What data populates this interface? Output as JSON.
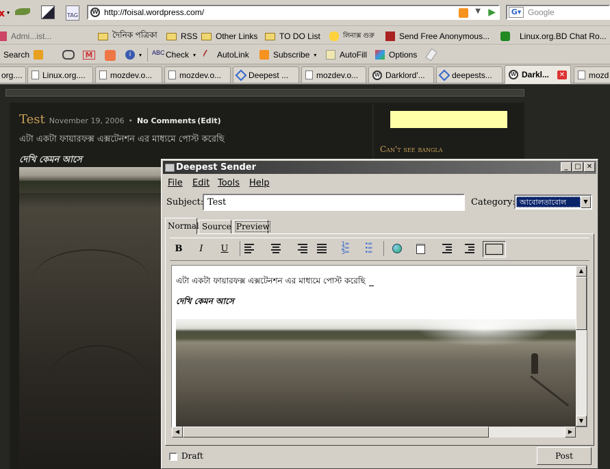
{
  "browser": {
    "url": "http://foisal.wordpress.com/",
    "search_placeholder": "Google",
    "bookmarks": [
      "Admi...ist...",
      "দৈনিক পত্রিকা",
      "RSS",
      "Other Links",
      "TO DO List",
      "লিনাক্স গুরু",
      "Send Free Anonymous...",
      "Linux.org.BD Chat Ro..."
    ],
    "toolbar": {
      "search": "Search",
      "check": "Check",
      "autolink": "AutoLink",
      "subscribe": "Subscribe",
      "autofill": "AutoFill",
      "options": "Options"
    },
    "tabs": [
      "org....",
      "Linux.org....",
      "mozdev.o...",
      "mozdev.o...",
      "Deepest ...",
      "mozdev.o...",
      "Darklord'...",
      "deepests...",
      "Darkl...",
      "mozd"
    ]
  },
  "page": {
    "post_title": "Test",
    "post_date": "November 19, 2006",
    "separator": "•",
    "comments": "No Comments",
    "edit": "(Edit)",
    "body_line1": "এটা একটা ফায়ারফক্স এক্সটেনশন এর মাধ্যমে পোস্ট করেছি",
    "body_line2": "দেখি কেমন আসে",
    "sidebar_heading": "Can't see bangla"
  },
  "dialog": {
    "title": "Deepest Sender",
    "menu": [
      "File",
      "Edit",
      "Tools",
      "Help"
    ],
    "subject_label": "Subject:",
    "subject_value": "Test",
    "category_label": "Category:",
    "category_value": "আবোলতাবোল",
    "editor_tabs": [
      "Normal",
      "Source",
      "Preview"
    ],
    "format_buttons": {
      "bold": "B",
      "italic": "I",
      "underline": "U"
    },
    "editor_line1": "এটা একটা ফায়ারফক্স এক্সটেনশন এর মাধ্যমে পোস্ট করেছি",
    "editor_line2": "দেখি কেমন আসে",
    "draft_label": "Draft",
    "post_button": "Post"
  },
  "colors": {
    "page_bg": "#262622",
    "post_title": "#c8a058",
    "sidebar_heading": "#c8a058",
    "selection": "#0a246a"
  }
}
